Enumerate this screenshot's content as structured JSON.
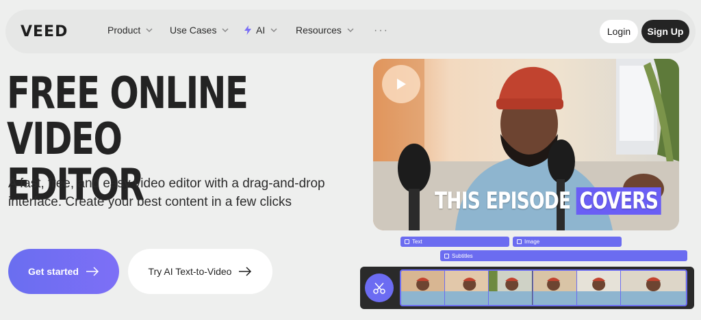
{
  "nav": {
    "logo": "VEED",
    "items": [
      {
        "label": "Product"
      },
      {
        "label": "Use Cases"
      },
      {
        "label": "AI"
      },
      {
        "label": "Resources"
      }
    ],
    "more": "···",
    "login": "Login",
    "signup": "Sign Up"
  },
  "hero": {
    "title_line1": "FREE ONLINE VIDEO",
    "title_line2": "EDITOR",
    "subtitle": "A fast, free, and easy video editor with a drag-and-drop interface. Create your best content in a few clicks",
    "cta_primary": "Get started",
    "cta_secondary": "Try AI Text-to-Video"
  },
  "video": {
    "caption_main": "THIS EPISODE ",
    "caption_highlight": "COVERS"
  },
  "timeline": {
    "text_track": "Text",
    "image_track": "Image",
    "subtitles_track": "Subtitles"
  },
  "colors": {
    "accent": "#6b6ff2",
    "dark_button": "#242424",
    "background": "#eeefee"
  },
  "icons": [
    "chevron-down-icon",
    "bolt-icon",
    "arrow-right-icon",
    "play-icon",
    "scissors-icon"
  ]
}
